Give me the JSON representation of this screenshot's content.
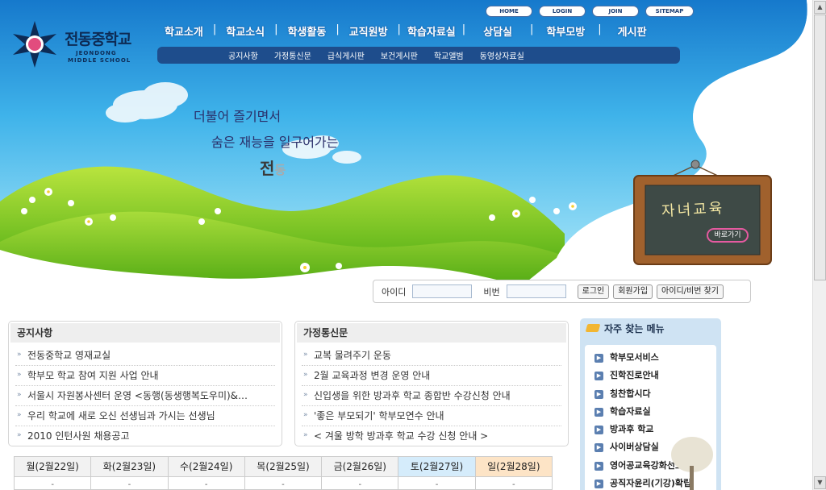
{
  "logo": {
    "name": "전동중학교",
    "eng_line1": "JEONDONG",
    "eng_line2": "MIDDLE SCHOOL",
    "emblem_text": "전동"
  },
  "util_links": [
    "HOME",
    "LOGIN",
    "JOIN",
    "SITEMAP"
  ],
  "main_nav": [
    "학교소개",
    "학교소식",
    "학생활동",
    "교직원방",
    "학습자료실",
    "상담실",
    "학부모방",
    "게시판"
  ],
  "sub_nav": [
    "공지사항",
    "가정통신문",
    "급식게시판",
    "보건게시판",
    "학교앨범",
    "동영상자료실"
  ],
  "slogan": {
    "line1": "더불어 즐기면서",
    "line2": "숨은 재능을 일구어가는",
    "line3a": "전",
    "line3b": "동"
  },
  "chalkboard": {
    "title": "자녀교육",
    "button": "바로가기"
  },
  "login": {
    "id_label": "아이디",
    "pw_label": "비번",
    "login_btn": "로그인",
    "join_btn": "회원가입",
    "find_btn": "아이디/비번 찾기"
  },
  "notice": {
    "title": "공지사항",
    "items": [
      "전동중학교 영재교실",
      "학부모 학교 참여 지원 사업 안내",
      "서울시 자원봉사센터 운영 <동행(동생행복도우미)&…",
      "우리 학교에 새로 오신 선생님과 가시는 선생님",
      "2010 인턴사원 채용공고"
    ]
  },
  "letters": {
    "title": "가정통신문",
    "items": [
      "교복 물려주기 운동",
      "2월 교육과정 변경 운영 안내",
      "신입생을 위한 방과후 학교 종합반 수강신청 안내",
      "'좋은 부모되기' 학부모연수 안내",
      "< 겨울 방학 방과후 학교 수강 신청 안내 >"
    ]
  },
  "quick_menu": {
    "title": "자주 찾는 메뉴",
    "items": [
      "학부모서비스",
      "진학진로안내",
      "칭찬합시다",
      "학습자료실",
      "방과후 학교",
      "사이버상담실",
      "영어공교육강화선도학교",
      "공직자윤리(기강)확립"
    ]
  },
  "calendar": {
    "days": [
      "월(2월22일)",
      "화(2월23일)",
      "수(2월24일)",
      "목(2월25일)",
      "금(2월26일)",
      "토(2월27일)",
      "일(2월28일)"
    ]
  },
  "colors": {
    "sky": "#1f8fd6",
    "nav_bar": "#1e4d8c",
    "grass": "#6bbf1e",
    "quick_bg": "#cfe3f3"
  }
}
